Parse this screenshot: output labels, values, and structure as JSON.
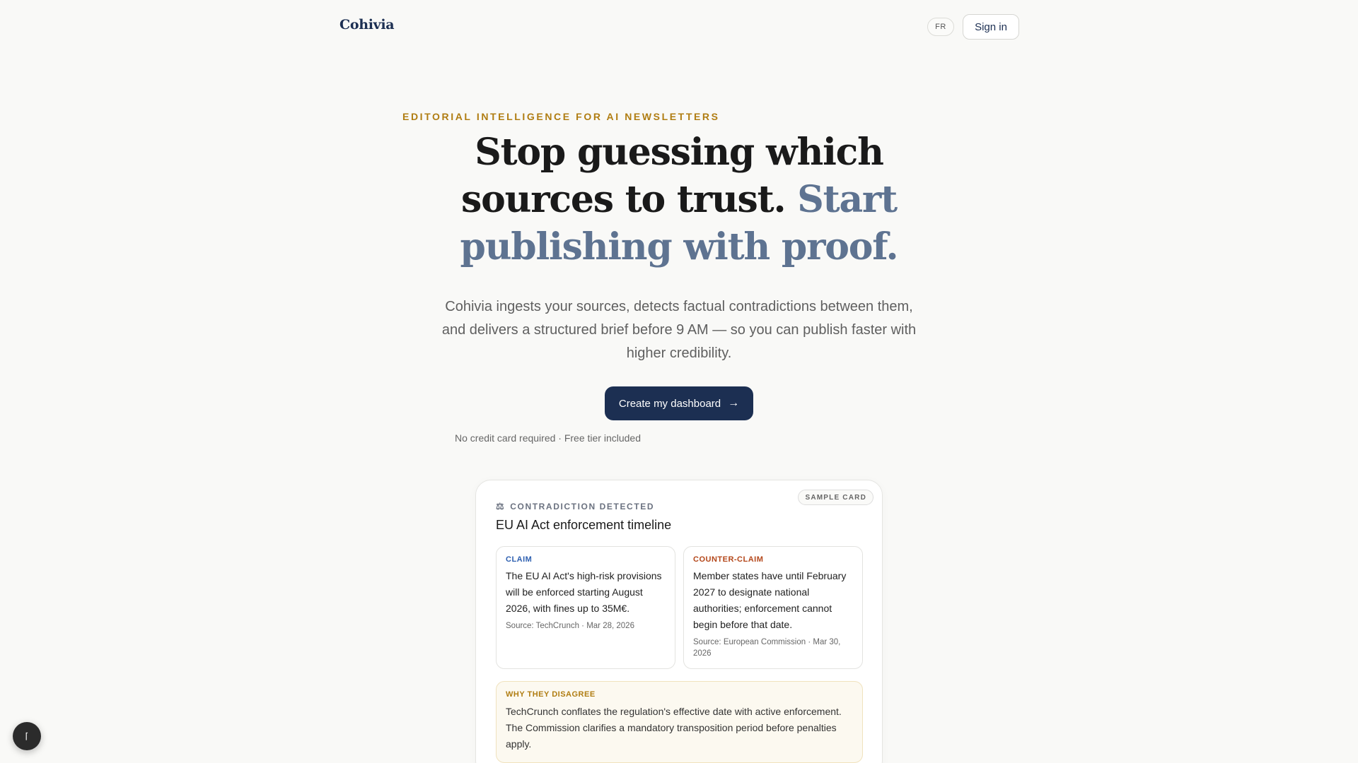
{
  "header": {
    "logo": "Cohivia",
    "lang_label": "FR",
    "signin_label": "Sign in"
  },
  "hero": {
    "eyebrow": "EDITORIAL INTELLIGENCE FOR AI NEWSLETTERS",
    "headline_main": "Stop guessing which sources to trust.",
    "headline_accent": "Start publishing with proof.",
    "subtext": "Cohivia ingests your sources, detects factual contradictions between them, and delivers a structured brief before 9 AM — so you can publish faster with higher credibility.",
    "cta_label": "Create my dashboard",
    "cta_icon": "→",
    "note": "No credit card required · Free tier included"
  },
  "card": {
    "badge": "SAMPLE CARD",
    "kicker_icon": "⚖",
    "kicker": "CONTRADICTION DETECTED",
    "title": "EU AI Act enforcement timeline",
    "claim": {
      "label": "CLAIM",
      "text": "The EU AI Act's high-risk provisions will be enforced starting August 2026, with fines up to 35M€.",
      "source": "Source: TechCrunch · Mar 28, 2026"
    },
    "counter_claim": {
      "label": "COUNTER-CLAIM",
      "text": "Member states have until February 2027 to designate national authorities; enforcement cannot begin before that date.",
      "source": "Source: European Commission · Mar 30, 2026"
    },
    "why": {
      "label": "WHY THEY DISAGREE",
      "text": "TechCrunch conflates the regulation's effective date with active enforcement. The Commission clarifies a mandatory transposition period before penalties apply."
    }
  },
  "floating_button": {
    "label": "⌈"
  },
  "colors": {
    "brand_navy": "#1c2f52",
    "accent_gold": "#b07d12",
    "headline_accent": "#5e7391",
    "claim_blue": "#2d5fb0",
    "counter_red": "#b4471a"
  }
}
